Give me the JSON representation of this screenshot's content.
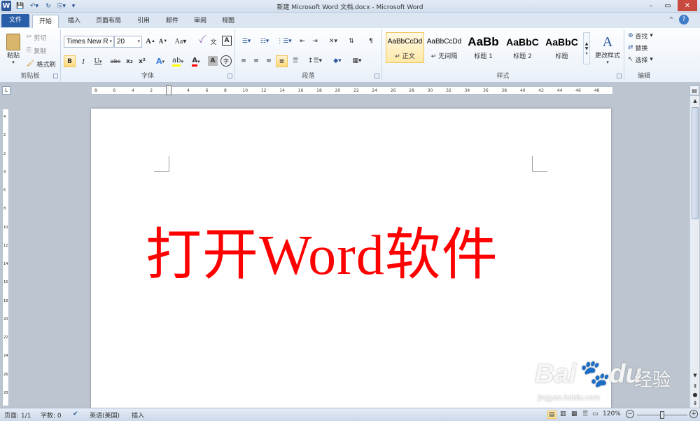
{
  "window": {
    "title": "新建 Microsoft Word 文档.docx - Microsoft Word",
    "app_icon": "W"
  },
  "tabs": [
    "文件",
    "开始",
    "插入",
    "页面布局",
    "引用",
    "邮件",
    "审阅",
    "视图"
  ],
  "clipboard": {
    "paste": "粘贴",
    "cut": "剪切",
    "copy": "复制",
    "format_painter": "格式刷",
    "label": "剪贴板"
  },
  "font": {
    "name": "Times New R",
    "size": "20",
    "label": "字体",
    "grow": "A",
    "shrink": "A",
    "case": "Aa",
    "bold": "B",
    "italic": "I",
    "underline": "U",
    "strike": "abc",
    "sub": "x₂",
    "sup": "x²"
  },
  "paragraph": {
    "label": "段落"
  },
  "styles": {
    "label": "样式",
    "items": [
      {
        "preview": "AaBbCcDd",
        "name": "正文"
      },
      {
        "preview": "AaBbCcDd",
        "name": "无间隔"
      },
      {
        "preview": "AaBb",
        "name": "标题 1"
      },
      {
        "preview": "AaBbC",
        "name": "标题 2"
      },
      {
        "preview": "AaBbC",
        "name": "标题"
      }
    ],
    "change": "更改样式"
  },
  "editing": {
    "find": "查找",
    "replace": "替换",
    "select": "选择",
    "label": "编辑"
  },
  "ruler": {
    "top_ticks": [
      "8",
      "6",
      "4",
      "2",
      "2",
      "4",
      "6",
      "8",
      "10",
      "12",
      "14",
      "16",
      "18",
      "20",
      "22",
      "24",
      "26",
      "28",
      "30",
      "32",
      "34",
      "36",
      "38",
      "40",
      "42",
      "44",
      "46",
      "48"
    ],
    "left_ticks": [
      "4",
      "2",
      "2",
      "4",
      "6",
      "8",
      "10",
      "12",
      "14",
      "16",
      "18",
      "20",
      "22",
      "24",
      "26",
      "28"
    ]
  },
  "document": {
    "text": "打开Word软件",
    "text_color": "#ff0000"
  },
  "status": {
    "page": "页面: 1/1",
    "words": "字数: 0",
    "language": "英语(美国)",
    "mode": "插入",
    "zoom": "120%"
  },
  "watermark": {
    "brand": "Bai",
    "brand2": "du",
    "brand_cn": "经验",
    "url": "jingyan.baidu.com"
  }
}
